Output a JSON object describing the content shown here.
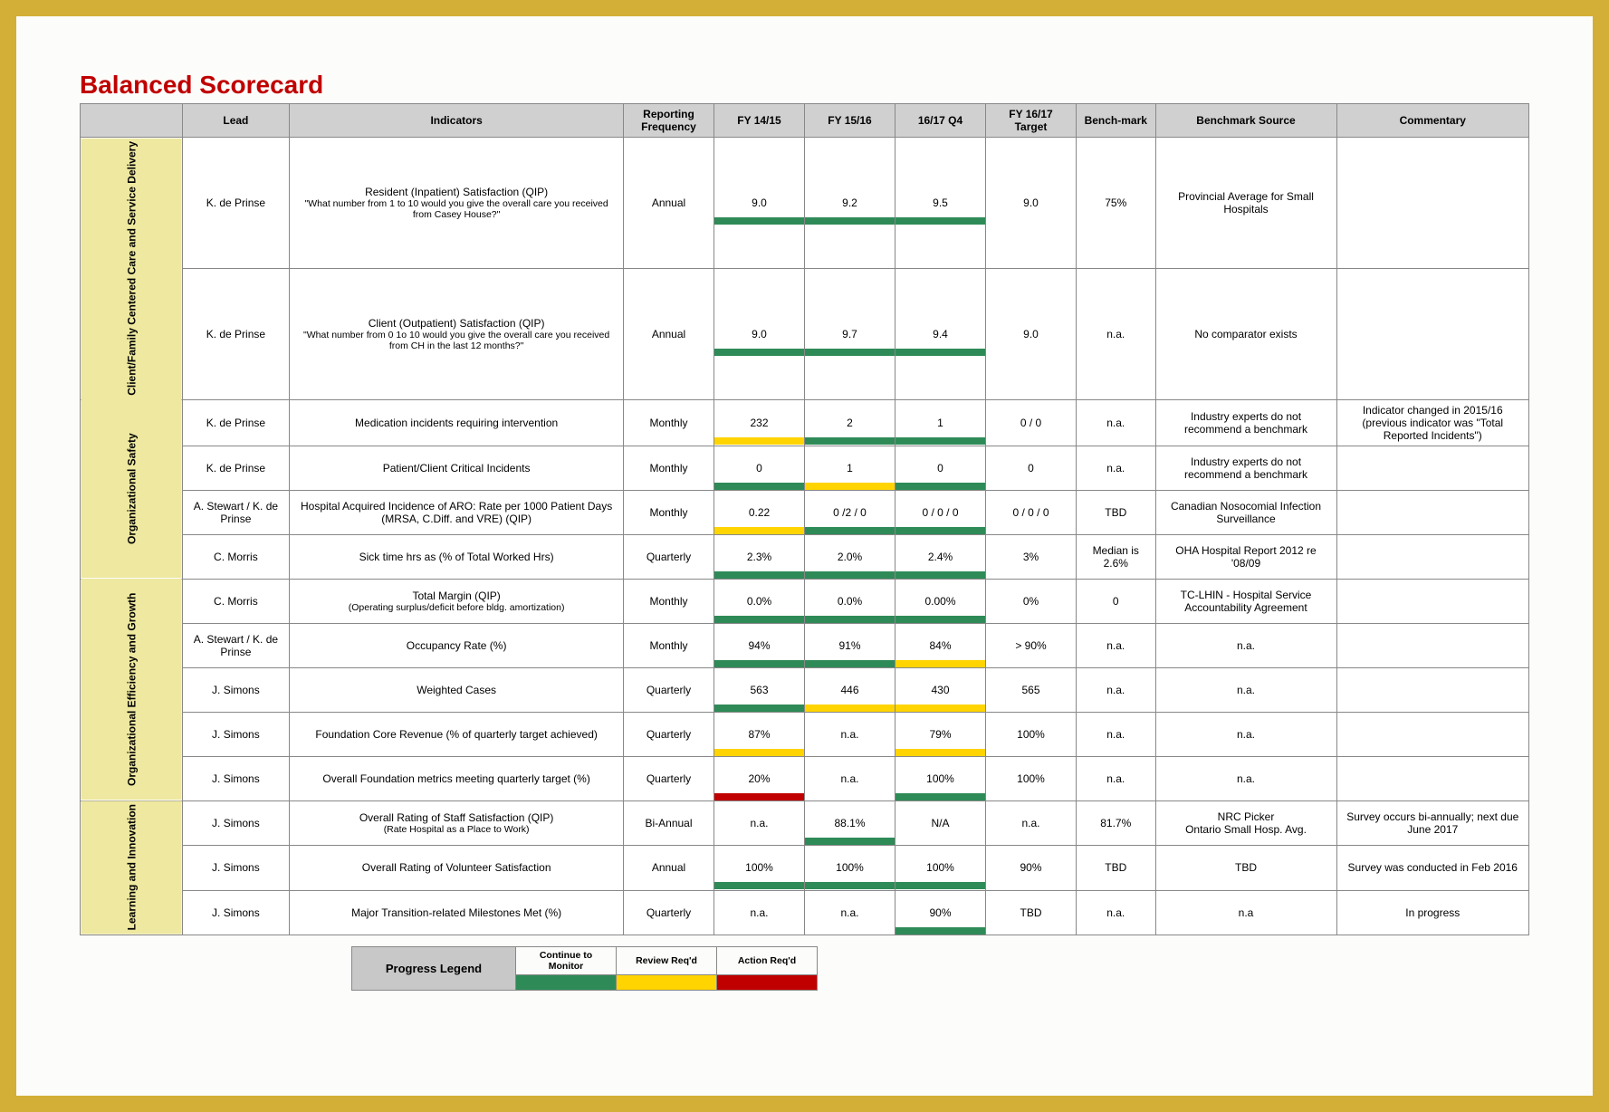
{
  "title": "Balanced Scorecard",
  "headers": {
    "lead": "Lead",
    "indicators": "Indicators",
    "reporting_frequency": "Reporting Frequency",
    "fy1415": "FY 14/15",
    "fy1516": "FY 15/16",
    "q4_1617": "16/17 Q4",
    "fy1617_target": "FY 16/17 Target",
    "benchmark": "Bench-mark",
    "benchmark_source": "Benchmark Source",
    "commentary": "Commentary"
  },
  "categories": [
    {
      "name": "Client/Family Centered Care and Service Delivery",
      "rows": [
        {
          "lead": "K. de Prinse",
          "indicator": "Resident (Inpatient) Satisfaction (QIP)",
          "indicator_sub": "\"What number from 1 to 10 would you give the overall care you received from Casey House?\"",
          "freq": "Annual",
          "v1415": {
            "v": "9.0",
            "bar": "green"
          },
          "v1516": {
            "v": "9.2",
            "bar": "green"
          },
          "vq4": {
            "v": "9.5",
            "bar": "green"
          },
          "target": {
            "v": "9.0",
            "bar": "none"
          },
          "bench": "75%",
          "bsrc": "Provincial Average for Small Hospitals",
          "comm": ""
        },
        {
          "lead": "K. de Prinse",
          "indicator": "Client (Outpatient) Satisfaction (QIP)",
          "indicator_sub": "\"What number from 0 1o 10 would you give the overall care you received from CH in the last 12 months?\"",
          "freq": "Annual",
          "v1415": {
            "v": "9.0",
            "bar": "green"
          },
          "v1516": {
            "v": "9.7",
            "bar": "green"
          },
          "vq4": {
            "v": "9.4",
            "bar": "green"
          },
          "target": {
            "v": "9.0",
            "bar": "none"
          },
          "bench": "n.a.",
          "bsrc": "No comparator exists",
          "comm": ""
        }
      ]
    },
    {
      "name": "Organizational Safety",
      "rows": [
        {
          "lead": "K. de Prinse",
          "indicator": "Medication incidents requiring intervention",
          "indicator_sub": "",
          "freq": "Monthly",
          "v1415": {
            "v": "232",
            "bar": "yellow"
          },
          "v1516": {
            "v": "2",
            "bar": "green"
          },
          "vq4": {
            "v": "1",
            "bar": "green"
          },
          "target": {
            "v": "0 / 0",
            "bar": "none"
          },
          "bench": "n.a.",
          "bsrc": "Industry experts do not recommend a benchmark",
          "comm": "Indicator changed in 2015/16 (previous indicator was \"Total Reported Incidents\")"
        },
        {
          "lead": "K. de Prinse",
          "indicator": "Patient/Client Critical Incidents",
          "indicator_sub": "",
          "freq": "Monthly",
          "v1415": {
            "v": "0",
            "bar": "green"
          },
          "v1516": {
            "v": "1",
            "bar": "yellow"
          },
          "vq4": {
            "v": "0",
            "bar": "green"
          },
          "target": {
            "v": "0",
            "bar": "none"
          },
          "bench": "n.a.",
          "bsrc": "Industry experts do not recommend a benchmark",
          "comm": ""
        },
        {
          "lead": "A. Stewart / K. de Prinse",
          "indicator": "Hospital Acquired Incidence of ARO: Rate per 1000 Patient Days (MRSA, C.Diff. and VRE) (QIP)",
          "indicator_sub": "",
          "freq": "Monthly",
          "v1415": {
            "v": "0.22",
            "bar": "yellow"
          },
          "v1516": {
            "v": "0 /2 / 0",
            "bar": "green"
          },
          "vq4": {
            "v": "0 / 0 / 0",
            "bar": "green"
          },
          "target": {
            "v": "0 / 0 / 0",
            "bar": "none"
          },
          "bench": "TBD",
          "bsrc": "Canadian Nosocomial Infection Surveillance",
          "comm": ""
        },
        {
          "lead": "C. Morris",
          "indicator": "Sick time hrs as (% of Total Worked Hrs)",
          "indicator_sub": "",
          "freq": "Quarterly",
          "v1415": {
            "v": "2.3%",
            "bar": "green"
          },
          "v1516": {
            "v": "2.0%",
            "bar": "green"
          },
          "vq4": {
            "v": "2.4%",
            "bar": "green"
          },
          "target": {
            "v": "3%",
            "bar": "none"
          },
          "bench": "Median is 2.6%",
          "bsrc": "OHA Hospital Report 2012 re '08/09",
          "comm": ""
        }
      ]
    },
    {
      "name": "Organizational Efficiency and Growth",
      "rows": [
        {
          "lead": "C. Morris",
          "indicator": "Total Margin (QIP)",
          "indicator_sub": "(Operating surplus/deficit before bldg. amortization)",
          "freq": "Monthly",
          "v1415": {
            "v": "0.0%",
            "bar": "green"
          },
          "v1516": {
            "v": "0.0%",
            "bar": "green"
          },
          "vq4": {
            "v": "0.00%",
            "bar": "green"
          },
          "target": {
            "v": "0%",
            "bar": "none"
          },
          "bench": "0",
          "bsrc": "TC-LHIN - Hospital Service Accountability Agreement",
          "comm": ""
        },
        {
          "lead": "A. Stewart / K. de Prinse",
          "indicator": "Occupancy Rate (%)",
          "indicator_sub": "",
          "freq": "Monthly",
          "v1415": {
            "v": "94%",
            "bar": "green"
          },
          "v1516": {
            "v": "91%",
            "bar": "green"
          },
          "vq4": {
            "v": "84%",
            "bar": "yellow"
          },
          "target": {
            "v": "> 90%",
            "bar": "none"
          },
          "bench": "n.a.",
          "bsrc": "n.a.",
          "comm": ""
        },
        {
          "lead": "J. Simons",
          "indicator": "Weighted Cases",
          "indicator_sub": "",
          "freq": "Quarterly",
          "v1415": {
            "v": "563",
            "bar": "green"
          },
          "v1516": {
            "v": "446",
            "bar": "yellow"
          },
          "vq4": {
            "v": "430",
            "bar": "yellow"
          },
          "target": {
            "v": "565",
            "bar": "none"
          },
          "bench": "n.a.",
          "bsrc": "n.a.",
          "comm": ""
        },
        {
          "lead": "J. Simons",
          "indicator": "Foundation Core Revenue (% of quarterly target achieved)",
          "indicator_sub": "",
          "freq": "Quarterly",
          "v1415": {
            "v": "87%",
            "bar": "yellow"
          },
          "v1516": {
            "v": "n.a.",
            "bar": "none"
          },
          "vq4": {
            "v": "79%",
            "bar": "yellow"
          },
          "target": {
            "v": "100%",
            "bar": "none"
          },
          "bench": "n.a.",
          "bsrc": "n.a.",
          "comm": ""
        },
        {
          "lead": "J. Simons",
          "indicator": "Overall Foundation metrics meeting quarterly target (%)",
          "indicator_sub": "",
          "freq": "Quarterly",
          "v1415": {
            "v": "20%",
            "bar": "red"
          },
          "v1516": {
            "v": "n.a.",
            "bar": "none"
          },
          "vq4": {
            "v": "100%",
            "bar": "green"
          },
          "target": {
            "v": "100%",
            "bar": "none"
          },
          "bench": "n.a.",
          "bsrc": "n.a.",
          "comm": ""
        }
      ]
    },
    {
      "name": "Learning and Innovation",
      "rows": [
        {
          "lead": "J. Simons",
          "indicator": "Overall Rating of Staff Satisfaction (QIP)",
          "indicator_sub": "(Rate Hospital as a Place to Work)",
          "freq": "Bi-Annual",
          "v1415": {
            "v": "n.a.",
            "bar": "none"
          },
          "v1516": {
            "v": "88.1%",
            "bar": "green"
          },
          "vq4": {
            "v": "N/A",
            "bar": "none"
          },
          "target": {
            "v": "n.a.",
            "bar": "none"
          },
          "bench": "81.7%",
          "bsrc": "NRC Picker\nOntario Small Hosp. Avg.",
          "comm": "Survey occurs bi-annually; next due June 2017"
        },
        {
          "lead": "J. Simons",
          "indicator": "Overall Rating of Volunteer Satisfaction",
          "indicator_sub": "",
          "freq": "Annual",
          "v1415": {
            "v": "100%",
            "bar": "green"
          },
          "v1516": {
            "v": "100%",
            "bar": "green"
          },
          "vq4": {
            "v": "100%",
            "bar": "green"
          },
          "target": {
            "v": "90%",
            "bar": "none"
          },
          "bench": "TBD",
          "bsrc": "TBD",
          "comm": "Survey was conducted in Feb 2016"
        },
        {
          "lead": "J. Simons",
          "indicator": "Major Transition-related Milestones Met (%)",
          "indicator_sub": "",
          "freq": "Quarterly",
          "v1415": {
            "v": "n.a.",
            "bar": "none"
          },
          "v1516": {
            "v": "n.a.",
            "bar": "none"
          },
          "vq4": {
            "v": "90%",
            "bar": "green"
          },
          "target": {
            "v": "TBD",
            "bar": "none"
          },
          "bench": "n.a.",
          "bsrc": "n.a",
          "comm": "In progress"
        }
      ]
    }
  ],
  "legend": {
    "title": "Progress Legend",
    "items": [
      {
        "label": "Continue to Monitor",
        "color": "green"
      },
      {
        "label": "Review Req'd",
        "color": "yellow"
      },
      {
        "label": "Action Req'd",
        "color": "red"
      }
    ]
  }
}
